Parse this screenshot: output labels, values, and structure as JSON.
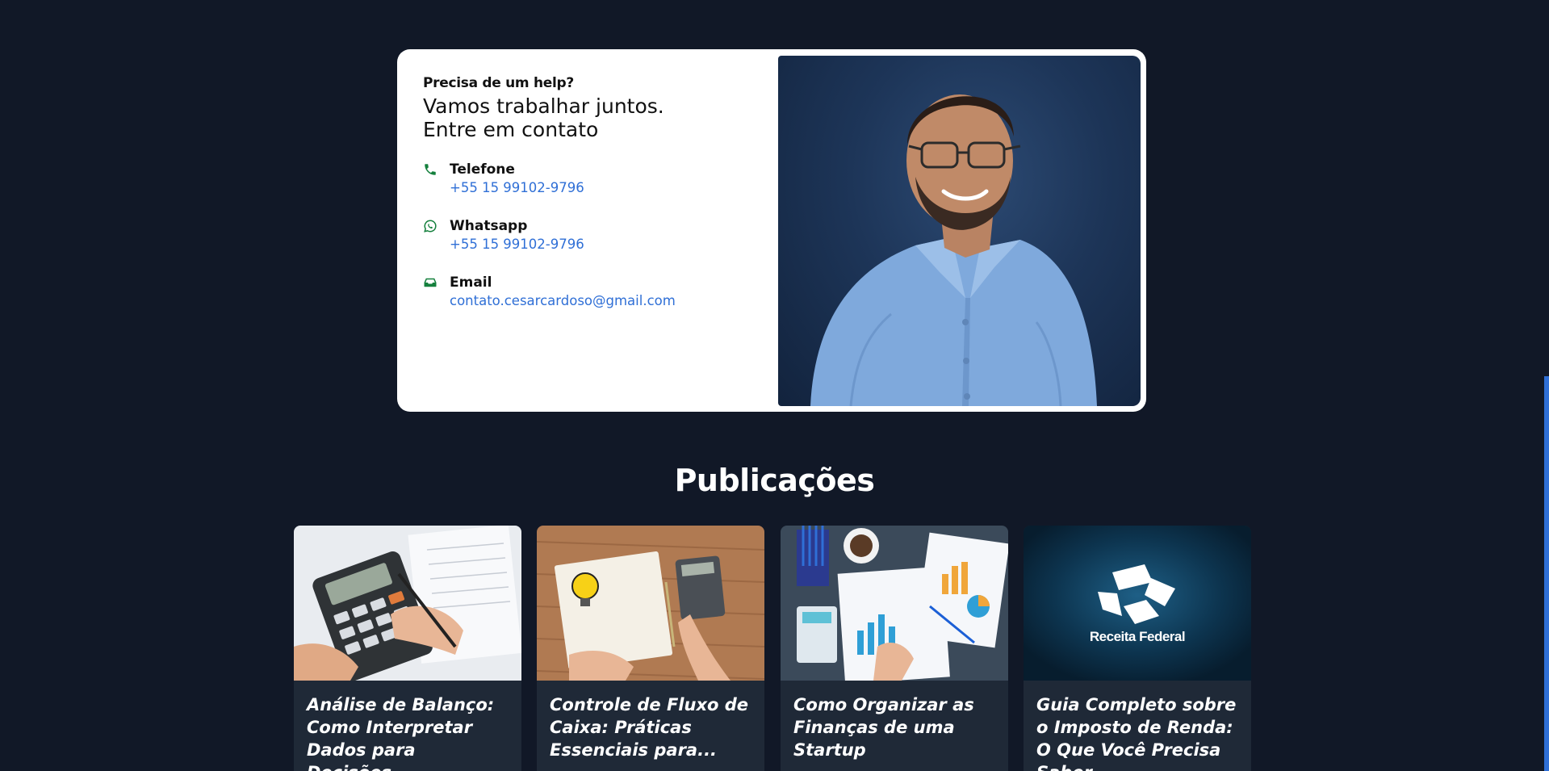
{
  "contact": {
    "eyebrow": "Precisa de um help?",
    "headline_line1": "Vamos trabalhar juntos.",
    "headline_line2": "Entre em contato",
    "items": [
      {
        "icon": "phone-icon",
        "label": "Telefone",
        "value": "+55 15 99102-9796"
      },
      {
        "icon": "whatsapp-icon",
        "label": "Whatsapp",
        "value": "+55 15 99102-9796"
      },
      {
        "icon": "inbox-icon",
        "label": "Email",
        "value": "contato.cesarcardoso@gmail.com"
      }
    ],
    "icon_color": "#15803d",
    "link_color": "#2f6fd6"
  },
  "publications": {
    "title": "Publicações",
    "cards": [
      {
        "title": "Análise de Balanço: Como Interpretar Dados para Decisões..."
      },
      {
        "title": "Controle de Fluxo de Caixa: Práticas Essenciais para..."
      },
      {
        "title": "Como Organizar as Finanças de uma Startup"
      },
      {
        "title": "Guia Completo sobre o Imposto de Renda: O Que Você Precisa Saber",
        "image_text": "Receita Federal"
      }
    ]
  },
  "colors": {
    "background": "#111827",
    "card": "#1f2937",
    "accent": "#2f6fd6"
  }
}
